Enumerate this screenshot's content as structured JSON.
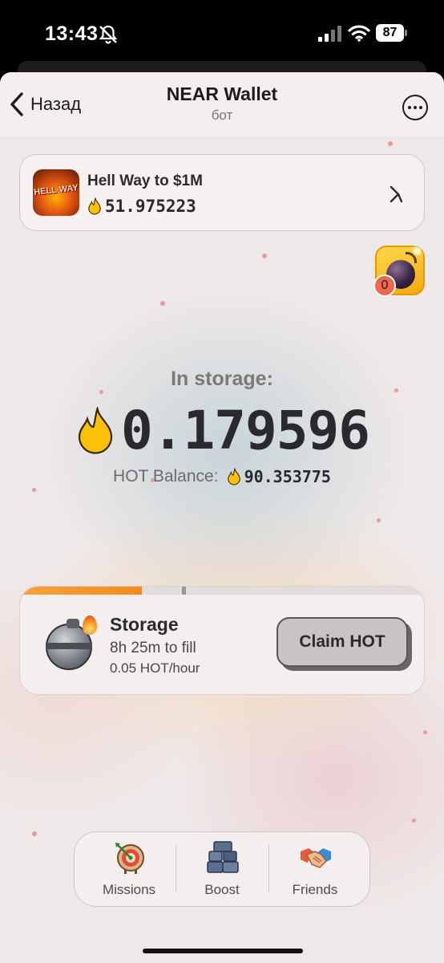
{
  "status_bar": {
    "time": "13:43",
    "battery": "87"
  },
  "header": {
    "back_label": "Назад",
    "title": "NEAR Wallet",
    "subtitle": "бот"
  },
  "game_card": {
    "title": "Hell Way to $1M",
    "balance": "51.975223",
    "thumb_text": "HELL WAY"
  },
  "bomb": {
    "count": "0"
  },
  "storage": {
    "label": "In storage:",
    "value": "0.179596",
    "hot_label": "HOT Balance:",
    "hot_value": "90.353775"
  },
  "storage_card": {
    "title": "Storage",
    "time_to_fill": "8h 25m to fill",
    "rate": "0.05 HOT/hour",
    "claim_label": "Claim HOT",
    "progress_fraction": 0.3
  },
  "bottom_nav": {
    "tabs": [
      {
        "label": "Missions"
      },
      {
        "label": "Boost"
      },
      {
        "label": "Friends"
      }
    ]
  },
  "colors": {
    "accent": "#F48A1F",
    "flame": "#FFC107",
    "badge": "#F0684C"
  },
  "icons": [
    "bell-slash-icon",
    "signal-icon",
    "wifi-icon",
    "battery-icon",
    "chevron-left-icon",
    "more-icon",
    "flame-icon",
    "bomb-icon",
    "storage-bomb-icon",
    "dartboard-icon",
    "boost-icon",
    "handshake-icon"
  ]
}
